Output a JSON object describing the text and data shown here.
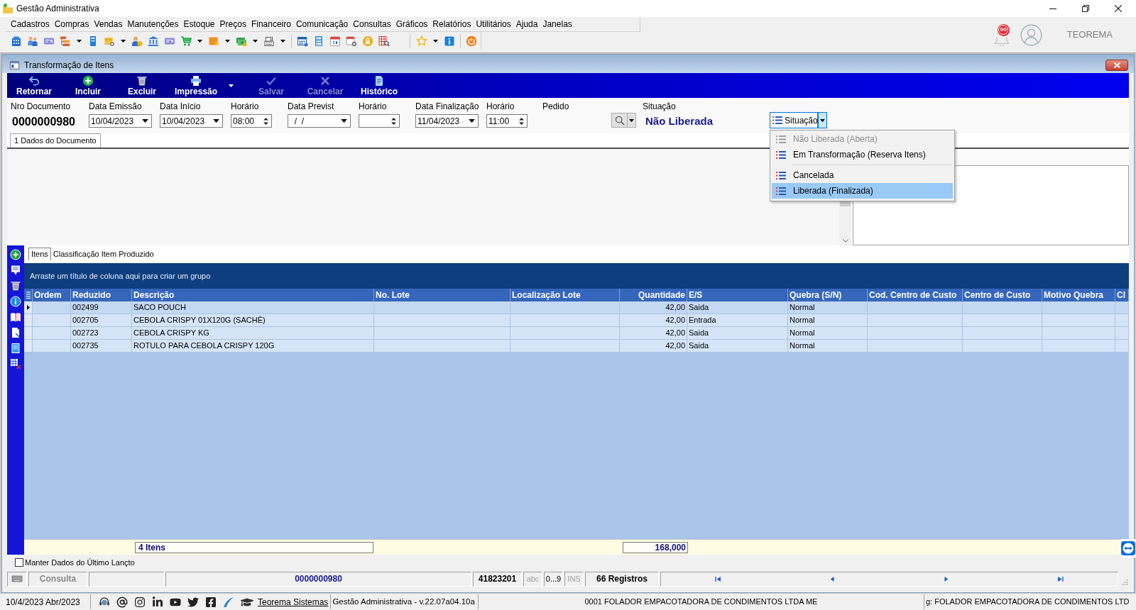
{
  "window": {
    "title": "Gestão Administrativa"
  },
  "menu_bar": [
    "Cadastros",
    "Compras",
    "Vendas",
    "Manutenções",
    "Estoque",
    "Preços",
    "Financeiro",
    "Comunicação",
    "Consultas",
    "Gráficos",
    "Relatórios",
    "Utilitários",
    "Ajuda",
    "Janelas"
  ],
  "notifications": {
    "badge": "00"
  },
  "user": {
    "name": "TEOREMA"
  },
  "child_window": {
    "title": "Transformação de Itens"
  },
  "actions": [
    {
      "label": "Retornar",
      "disabled": false,
      "has_menu": false
    },
    {
      "label": "Incluir",
      "disabled": false,
      "has_menu": false
    },
    {
      "label": "Excluir",
      "disabled": false,
      "has_menu": false
    },
    {
      "label": "Impressão",
      "disabled": false,
      "has_menu": true
    },
    {
      "label": "Salvar",
      "disabled": true,
      "has_menu": false
    },
    {
      "label": "Cancelar",
      "disabled": true,
      "has_menu": false
    },
    {
      "label": "Histórico",
      "disabled": false,
      "has_menu": false
    }
  ],
  "fields": [
    {
      "kind": "display",
      "label": "Nro Documento",
      "value": "0000000980"
    },
    {
      "kind": "date",
      "label": "Data Emissão",
      "value": "10/04/2023"
    },
    {
      "kind": "date",
      "label": "Data Início",
      "value": "10/04/2023"
    },
    {
      "kind": "time",
      "label": "Horário",
      "value": "08:00"
    },
    {
      "kind": "date",
      "label": "Data Previst",
      "value": "  /  /"
    },
    {
      "kind": "time",
      "label": "Horário"
    },
    {
      "kind": "date",
      "label": "Data Finalização",
      "value": "11/04/2023"
    },
    {
      "kind": "time",
      "label": "Horário",
      "value": "11:00"
    },
    {
      "kind": "lookup",
      "label": "Pedido"
    },
    {
      "kind": "status",
      "label": "Situação",
      "value": "Não Liberada"
    }
  ],
  "situacao_button": {
    "label": "Situação",
    "expanded": true
  },
  "situacao_menu": [
    {
      "kind": "item",
      "label": "Não Liberada (Aberta)",
      "disabled": true,
      "selected": false
    },
    {
      "kind": "item",
      "label": "Em Transformação (Reserva Itens)",
      "disabled": false,
      "selected": false
    },
    {
      "kind": "separator"
    },
    {
      "kind": "item",
      "label": "Cancelada",
      "disabled": false,
      "selected": false
    },
    {
      "kind": "item",
      "label": "Liberada (Finalizada)",
      "disabled": false,
      "selected": true
    }
  ],
  "document_tabs": [
    {
      "label": "1 Dados do Documento",
      "selected": true
    }
  ],
  "item_tabs": [
    {
      "label": "Itens",
      "selected": true
    },
    {
      "label": "Classificação Item Produzido",
      "selected": false
    }
  ],
  "grid": {
    "group_hint": "Arraste um título de coluna aqui para criar um grupo",
    "columns": [
      {
        "label": "Ordem",
        "kind": "text"
      },
      {
        "label": "Reduzido",
        "kind": "text"
      },
      {
        "label": "Descrição",
        "kind": "text"
      },
      {
        "label": "No. Lote",
        "kind": "text"
      },
      {
        "label": "Localização Lote",
        "kind": "text"
      },
      {
        "label": "Quantidade",
        "kind": "number"
      },
      {
        "label": "E/S",
        "kind": "text"
      },
      {
        "label": "Quebra (S/N)",
        "kind": "text"
      },
      {
        "label": "Cod. Centro de Custo",
        "kind": "text"
      },
      {
        "label": "Centro de Custo",
        "kind": "text"
      },
      {
        "label": "Motivo Quebra",
        "kind": "text"
      },
      {
        "label": "Cl",
        "kind": "text"
      }
    ],
    "rows": [
      {
        "selected": true,
        "reduzido": "002499",
        "descricao": "SACO POUCH",
        "quantidade": "42,00",
        "es": "Saida",
        "quebra": "Normal"
      },
      {
        "selected": false,
        "reduzido": "002705",
        "descricao": "CEBOLA CRISPY 01X120G (SACHÊ)",
        "quantidade": "42,00",
        "es": "Entrada",
        "quebra": "Normal"
      },
      {
        "selected": false,
        "reduzido": "002723",
        "descricao": "CEBOLA CRISPY KG",
        "quantidade": "42,00",
        "es": "Saida",
        "quebra": "Normal"
      },
      {
        "selected": false,
        "reduzido": "002735",
        "descricao": "ROTULO PARA CEBOLA CRISPY 120G",
        "quantidade": "42,00",
        "es": "Saida",
        "quebra": "Normal"
      }
    ],
    "footer": {
      "count": "4 Itens",
      "total": "168,000"
    }
  },
  "keep_last": {
    "label": "Manter Dados do Último Lançto",
    "checked": false
  },
  "status_bar": {
    "mode": "Consulta",
    "document": "0000000980",
    "code": "41823201",
    "indicators": [
      {
        "label": "abc",
        "on": false
      },
      {
        "label": "0...9",
        "on": true
      },
      {
        "label": "INS",
        "on": false
      }
    ],
    "records": "66 Registros"
  },
  "footer": {
    "date": "10/4/2023 Abr/2023",
    "link": "Teorema Sistemas",
    "version": "Gestão Administrativa - v.22.07a04.10a",
    "company": "0001 FOLADOR EMPACOTADORA DE CONDIMENTOS LTDA ME",
    "organization": "g: FOLADOR EMPACOTADORA DE CONDIMENTOS LTD"
  }
}
